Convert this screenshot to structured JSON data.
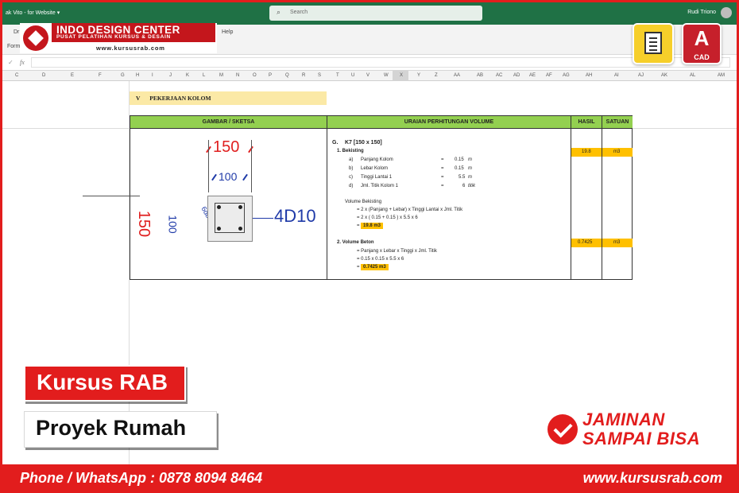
{
  "excel": {
    "doc_title": "ak Vito - for Website  ▾",
    "search_placeholder": "Search",
    "user_name": "Rudi Triono",
    "ribbon_tabs": [
      "Dr",
      "Help",
      "Form"
    ],
    "columns": [
      "C",
      "D",
      "E",
      "F",
      "G",
      "H",
      "I",
      "J",
      "K",
      "L",
      "M",
      "N",
      "O",
      "P",
      "Q",
      "R",
      "S",
      "T",
      "U",
      "V",
      "W",
      "X",
      "Y",
      "Z",
      "AA",
      "AB",
      "AC",
      "AD",
      "AE",
      "AF",
      "AG",
      "AH",
      "AI",
      "AJ",
      "AK",
      "AL",
      "AM"
    ],
    "fx": "fx",
    "check_mark": "✓"
  },
  "logo": {
    "name": "INDO DESIGN CENTER",
    "tagline": "PUSAT PELATIHAN KURSUS & DESAIN",
    "url": "www.kursusrab.com"
  },
  "apps": {
    "cad_letter": "A",
    "cad_label": "CAD",
    "doc_icon": "document-app-icon"
  },
  "sheet": {
    "section_num": "V",
    "section_title": "PEKERJAAN KOLOM",
    "headers": {
      "sketch": "GAMBAR / SKETSA",
      "calc": "URAIAN PERHITUNGAN VOLUME",
      "hasil": "HASIL",
      "satuan": "SATUAN"
    },
    "sketch": {
      "dim_top": "150",
      "dim_inner": "100",
      "dim_left": "150",
      "dim_left_inner": "100",
      "stirrup_label": "6db",
      "rebar_label": "4D10"
    },
    "calc": {
      "item_code": "G.",
      "item_name": "K7 [150 x 150]",
      "sub1": "1. Bekisting",
      "params": [
        {
          "key": "a)",
          "name": "Panjang Kolom",
          "eq": "=",
          "value": "0.15",
          "unit": "m"
        },
        {
          "key": "b)",
          "name": "Lebar Kolom",
          "eq": "=",
          "value": "0.15",
          "unit": "m"
        },
        {
          "key": "c)",
          "name": "Tinggi Lantai 1",
          "eq": "=",
          "value": "5.5",
          "unit": "m"
        },
        {
          "key": "d)",
          "name": "Jml. Titik Kolom 1",
          "eq": "=",
          "value": "6",
          "unit": "titik"
        }
      ],
      "vol_bek_label": "Volume Bekisting",
      "vol_bek_formula": "= 2 x (Panjang + Lebar) x Tinggi Lantai x Jml. Titik",
      "vol_bek_calc": "= 2 x ( 0.15 + 0.15 ) x 5.5 x 6",
      "vol_bek_eq": "=",
      "vol_bek_result": "19.8 m3",
      "sub2": "2. Volume Beton",
      "vol_beton_formula": "= Panjang x Lebar x Tinggi x Jml. Titik",
      "vol_beton_calc": "= 0.15 x 0.15 x 5.5 x 6",
      "vol_beton_eq": "=",
      "vol_beton_result": "0.7425 m3"
    },
    "results": [
      {
        "hasil": "19.8",
        "satuan": "m3"
      },
      {
        "hasil": "0.7425",
        "satuan": "m3"
      }
    ]
  },
  "promo": {
    "course": "Kursus RAB",
    "project": "Proyek Rumah",
    "guarantee_l1": "JAMINAN",
    "guarantee_l2": "SAMPAI BISA",
    "phone": "Phone / WhatsApp : 0878 8094 8464",
    "website": "www.kursusrab.com"
  },
  "colors": {
    "brand_red": "#e21d1d",
    "excel_green": "#1f7145",
    "header_green": "#93d050",
    "highlight": "#ffc000",
    "section_fill": "#fbe9a6"
  }
}
